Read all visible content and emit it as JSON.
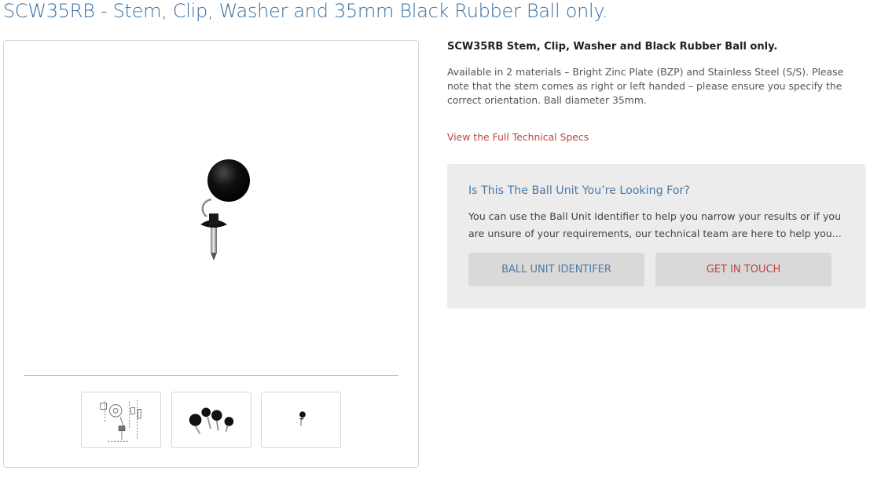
{
  "page": {
    "title": "SCW35RB - Stem, Clip, Washer and 35mm Black Rubber Ball only."
  },
  "gallery": {
    "main_image_alt": "SCW35RB black rubber ball unit",
    "thumbnails": [
      {
        "label": "technical drawing"
      },
      {
        "label": "ball unit group"
      },
      {
        "label": "single ball unit"
      }
    ]
  },
  "product": {
    "name": "SCW35RB Stem, Clip, Washer and Black Rubber Ball only.",
    "description": "Available in 2 materials – Bright Zinc Plate (BZP) and Stainless Steel (S/S). Please note that the stem comes as right or left handed – please ensure you specify the correct orientation. Ball diameter 35mm.",
    "specs_link": "View the Full Technical Specs"
  },
  "help_box": {
    "title": "Is This The Ball Unit You’re Looking For?",
    "text": "You can use the Ball Unit Identifier to help you narrow your results or if you are unsure of your requirements, our technical team are here to help you...",
    "identifier_button": "BALL UNIT IDENTIFER",
    "contact_button": "GET IN TOUCH"
  },
  "colors": {
    "title_blue": "#3a6fa0",
    "link_red": "#c0413f",
    "box_grey": "#ececec",
    "button_grey": "#d9d9d9"
  }
}
